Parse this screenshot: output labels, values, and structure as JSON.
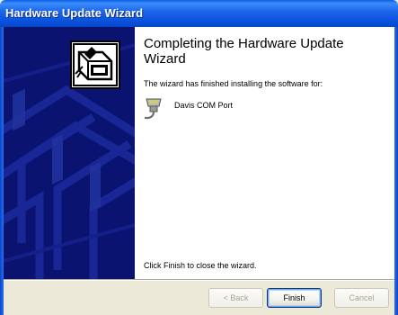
{
  "window": {
    "title": "Hardware Update Wizard"
  },
  "content": {
    "heading": "Completing the Hardware Update Wizard",
    "message": "The wizard has finished installing the software for:",
    "device_name": "Davis COM Port",
    "footer_text": "Click Finish to close the wizard."
  },
  "buttons": {
    "back_label": "< Back",
    "finish_label": "Finish",
    "cancel_label": "Cancel"
  },
  "icons": {
    "wizard": "hardware-wizard-icon",
    "device": "serial-port-connector-icon"
  },
  "colors": {
    "title_bar": "#0a5ee8",
    "banner": "#0a1370",
    "dialog_background": "#ece9d8"
  }
}
